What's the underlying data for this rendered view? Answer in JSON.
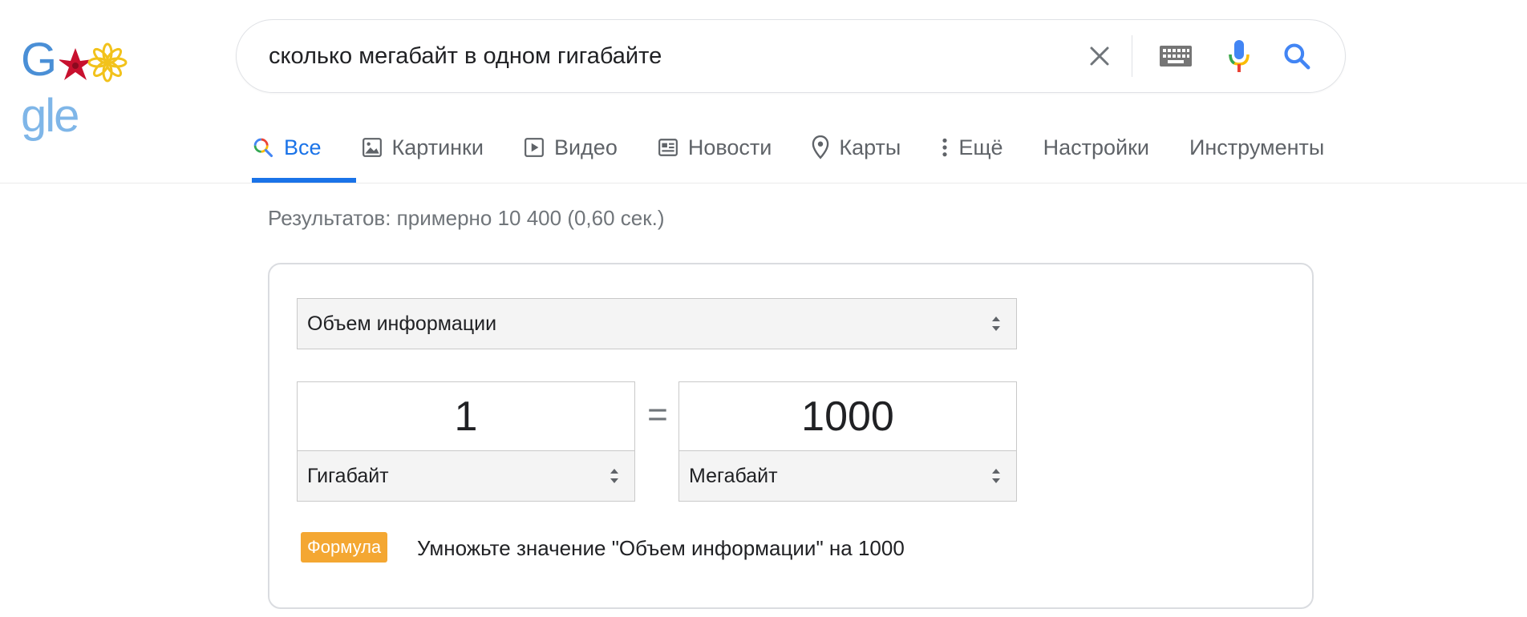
{
  "logo": {
    "text": "Google"
  },
  "search": {
    "query": "сколько мегабайт в одном гигабайте"
  },
  "tabs": [
    {
      "label": "Все",
      "icon": "search-icon",
      "active": true
    },
    {
      "label": "Картинки",
      "icon": "image-icon"
    },
    {
      "label": "Видео",
      "icon": "video-icon"
    },
    {
      "label": "Новости",
      "icon": "news-icon"
    },
    {
      "label": "Карты",
      "icon": "map-pin-icon"
    },
    {
      "label": "Ещё",
      "icon": "more-vert-icon"
    },
    {
      "label": "Настройки"
    },
    {
      "label": "Инструменты"
    }
  ],
  "results_stats": "Результатов: примерно 10 400 (0,60 сек.)",
  "converter": {
    "category": "Объем информации",
    "from_value": "1",
    "from_unit": "Гигабайт",
    "equals": "=",
    "to_value": "1000",
    "to_unit": "Мегабайт",
    "formula_label": "Формула",
    "formula_text": "Умножьте значение \"Объем информации\" на 1000"
  },
  "colors": {
    "accent": "#1a73e8",
    "formula_badge": "#f4a732",
    "secondary_text": "#70757a"
  }
}
